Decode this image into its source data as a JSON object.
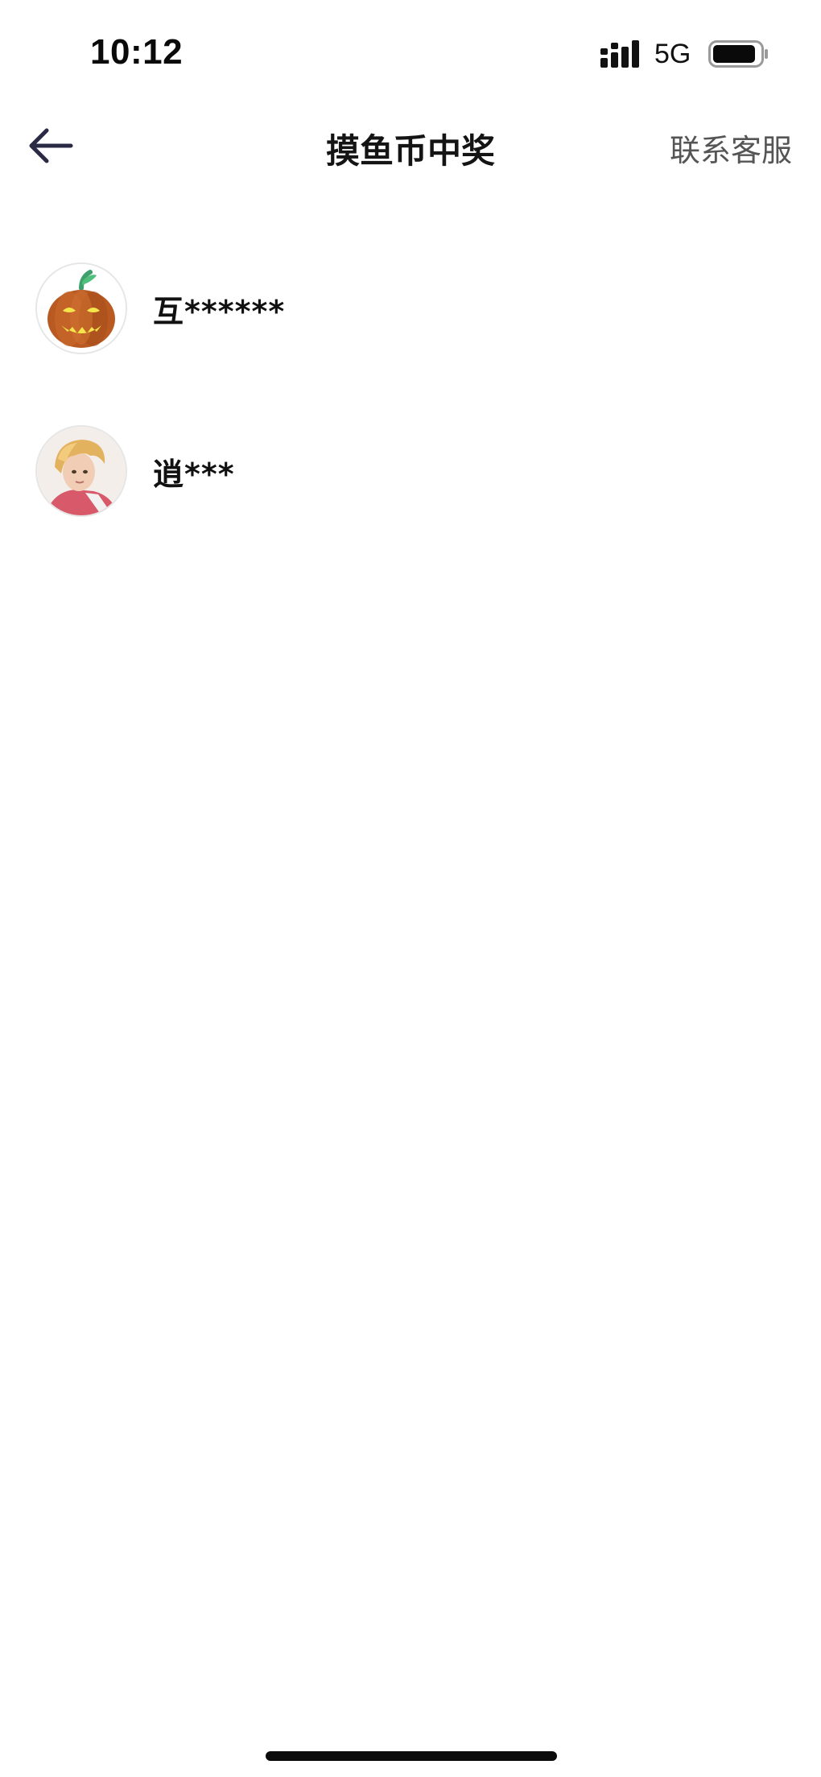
{
  "status_bar": {
    "time": "10:12",
    "network": "5G",
    "signal_icon": "signal-bars-icon",
    "battery_icon": "battery-icon"
  },
  "nav": {
    "back_icon": "back-arrow-icon",
    "title": "摸鱼币中奖",
    "contact_label": "联系客服"
  },
  "winners": [
    {
      "name": "互******",
      "avatar_icon": "pumpkin-avatar"
    },
    {
      "name": "逍***",
      "avatar_icon": "character-avatar"
    }
  ],
  "colors": {
    "background": "#ffffff",
    "title_text": "#141414",
    "contact_text": "#555555",
    "back_arrow": "#2b2a45"
  }
}
